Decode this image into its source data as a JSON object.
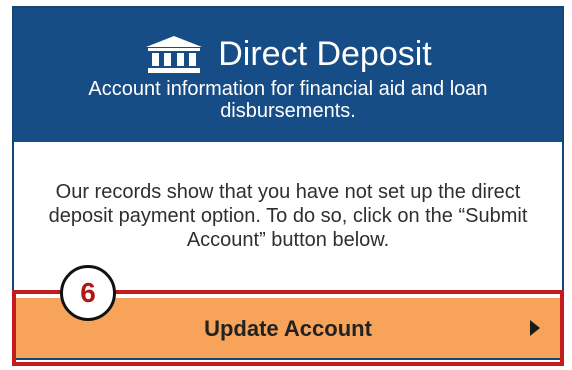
{
  "header": {
    "title": "Direct Deposit",
    "subtitle": "Account information for financial aid and loan disbursements.",
    "icon": "bank-icon"
  },
  "message": "Our records show that you have not set up the direct deposit payment option. To do so, click on the “Submit Account” button below.",
  "action": {
    "label": "Update Account",
    "icon": "chevron-right-icon"
  },
  "annotation": {
    "step_number": "6"
  },
  "colors": {
    "header_bg": "#174d86",
    "button_bg": "#f7a35a",
    "highlight": "#c41c1c"
  }
}
